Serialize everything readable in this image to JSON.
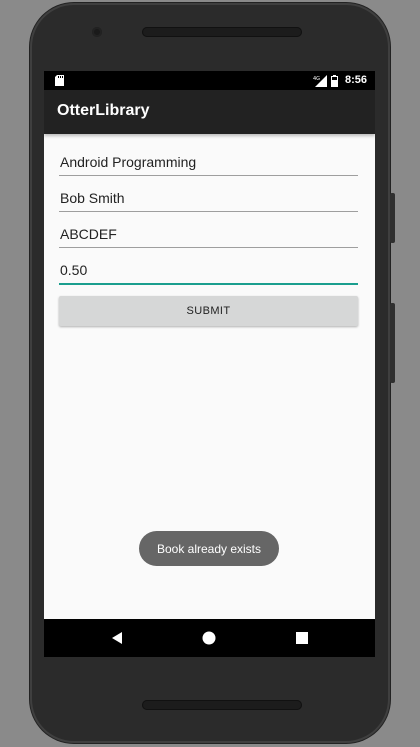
{
  "status_bar": {
    "time": "8:56",
    "network_label": "4G",
    "icons": [
      "sd-card-icon",
      "signal-icon",
      "battery-icon"
    ]
  },
  "app_bar": {
    "title": "OtterLibrary"
  },
  "form": {
    "fields": [
      {
        "value": "Android Programming"
      },
      {
        "value": "Bob Smith"
      },
      {
        "value": "ABCDEF"
      },
      {
        "value": "0.50"
      }
    ],
    "submit_label": "SUBMIT"
  },
  "toast": {
    "message": "Book already exists"
  },
  "nav_bar": {
    "icons": [
      "back-icon",
      "home-icon",
      "recents-icon"
    ]
  },
  "colors": {
    "accent": "#1a9e8e",
    "app_bar": "#222222",
    "screen_background": "#fafafa",
    "button_background": "#d6d7d7",
    "toast_background": "#666666"
  }
}
